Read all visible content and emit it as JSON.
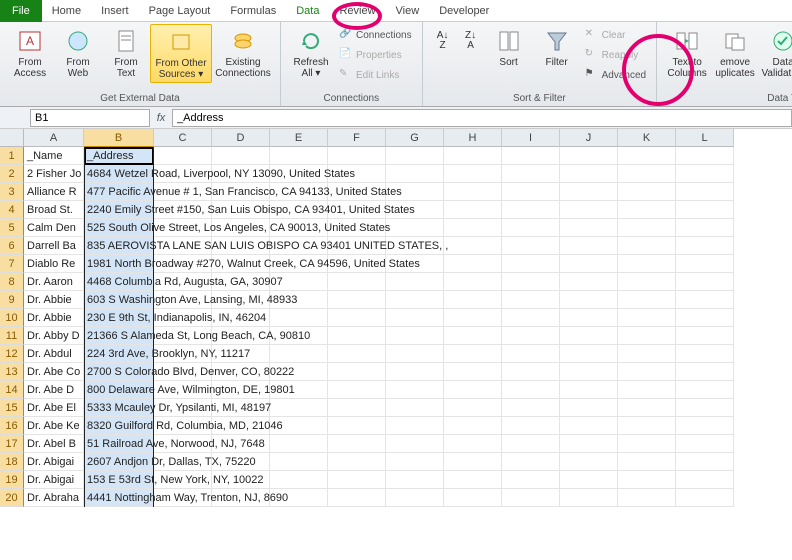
{
  "tabs": {
    "file": "File",
    "items": [
      "Home",
      "Insert",
      "Page Layout",
      "Formulas",
      "Data",
      "Review",
      "View",
      "Developer"
    ],
    "active": "Data"
  },
  "ribbon": {
    "ext": {
      "access": "From\nAccess",
      "web": "From\nWeb",
      "text": "From\nText",
      "other": "From Other\nSources ▾",
      "existing": "Existing\nConnections",
      "label": "Get External Data"
    },
    "conn": {
      "refresh": "Refresh\nAll ▾",
      "connections": "Connections",
      "properties": "Properties",
      "editlinks": "Edit Links",
      "label": "Connections"
    },
    "sortfilter": {
      "sort": "Sort",
      "filter": "Filter",
      "clear": "Clear",
      "reapply": "Reapply",
      "advanced": "Advanced",
      "label": "Sort & Filter"
    },
    "datatools": {
      "t2c": "Text to\nColumns",
      "removedup": "emove\nuplicates",
      "validation": "Data\nValidation",
      "label": "Data Too"
    }
  },
  "formula_bar": {
    "name": "B1",
    "value": "_Address"
  },
  "columns": [
    "A",
    "B",
    "C",
    "D",
    "E",
    "F",
    "G",
    "H",
    "I",
    "J",
    "K",
    "L"
  ],
  "sheet": {
    "headers": {
      "A": "_Name",
      "B": "_Address"
    },
    "rows": [
      {
        "n": "2 Fisher Jo",
        "a": "4684 Wetzel Road, Liverpool, NY 13090, United States"
      },
      {
        "n": "Alliance R",
        "a": "477 Pacific Avenue # 1, San Francisco, CA 94133, United States"
      },
      {
        "n": "Broad St.",
        "a": "2240 Emily Street #150, San Luis Obispo, CA 93401, United States"
      },
      {
        "n": "Calm Den",
        "a": "525 South Olive Street, Los Angeles, CA 90013, United States"
      },
      {
        "n": "Darrell Ba",
        "a": "835 AEROVISTA LANE  SAN LUIS OBISPO  CA 93401  UNITED STATES, ,"
      },
      {
        "n": "Diablo Re",
        "a": "1981 North Broadway #270, Walnut Creek, CA 94596, United States"
      },
      {
        "n": "Dr. Aaron",
        "a": "4468 Columbia Rd, Augusta, GA, 30907"
      },
      {
        "n": "Dr. Abbie",
        "a": "603 S Washington Ave, Lansing, MI, 48933"
      },
      {
        "n": "Dr. Abbie",
        "a": "230 E 9th St, Indianapolis, IN, 46204"
      },
      {
        "n": "Dr. Abby D",
        "a": "21366 S Alameda St, Long Beach, CA, 90810"
      },
      {
        "n": "Dr. Abdul",
        "a": "224 3rd Ave, Brooklyn, NY, 11217"
      },
      {
        "n": "Dr. Abe Co",
        "a": "2700 S Colorado Blvd, Denver, CO, 80222"
      },
      {
        "n": "Dr. Abe D",
        "a": "800 Delaware Ave, Wilmington, DE, 19801"
      },
      {
        "n": "Dr. Abe El",
        "a": "5333 Mcauley Dr, Ypsilanti, MI, 48197"
      },
      {
        "n": "Dr. Abe Ke",
        "a": "8320 Guilford Rd, Columbia, MD, 21046"
      },
      {
        "n": "Dr. Abel B",
        "a": "51 Railroad Ave, Norwood, NJ, 7648"
      },
      {
        "n": "Dr. Abigai",
        "a": "2607 Andjon Dr, Dallas, TX, 75220"
      },
      {
        "n": "Dr. Abigai",
        "a": "153 E 53rd St, New York, NY, 10022"
      },
      {
        "n": "Dr. Abraha",
        "a": "4441 Nottingham Way, Trenton, NJ, 8690"
      }
    ]
  },
  "annotations": {
    "circle_data_tab": true,
    "circle_text_to_columns": true
  }
}
